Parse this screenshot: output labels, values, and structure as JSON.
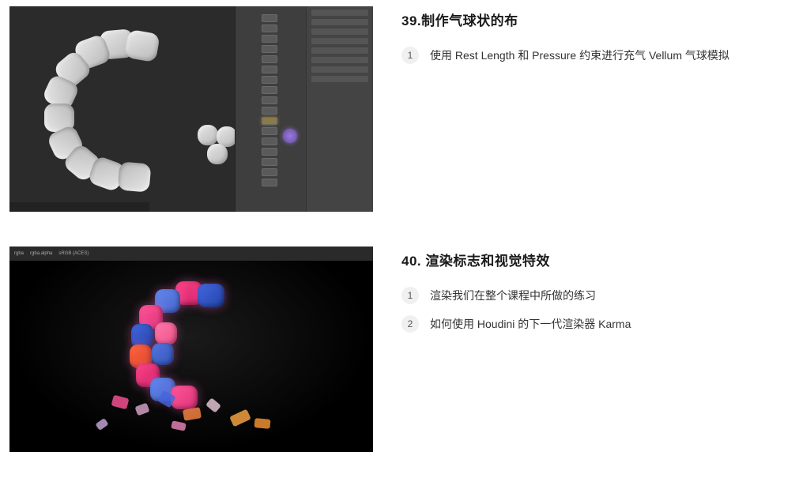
{
  "sections": [
    {
      "title": "39.制作气球状的布",
      "items": [
        {
          "num": "1",
          "text": "使用 Rest Length 和 Pressure 约束进行充气 Vellum 气球模拟"
        }
      ]
    },
    {
      "title": "40. 渲染标志和视觉特效",
      "items": [
        {
          "num": "1",
          "text": "渲染我们在整个课程中所做的练习"
        },
        {
          "num": "2",
          "text": "如何使用 Houdini 的下一代渲染器 Karma"
        }
      ]
    }
  ],
  "thumb2_topbar": {
    "rgba": "rgba",
    "alpha": "rgba.alpha",
    "srgb": "sRGB (ACES)"
  }
}
